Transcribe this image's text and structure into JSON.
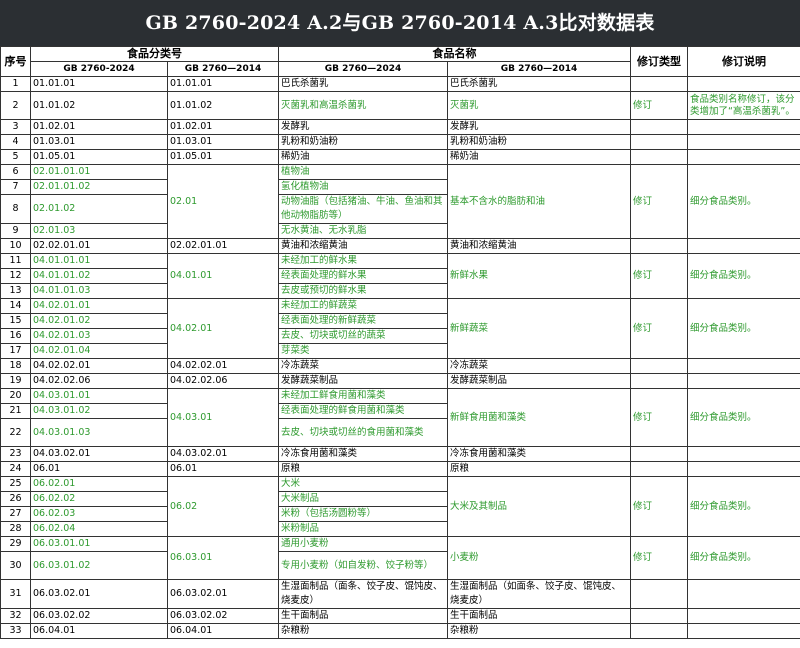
{
  "title": "GB 2760-2024 A.2与GB 2760-2014 A.3比对数据表",
  "headers": {
    "seq": "序号",
    "cat_group": "食品分类号",
    "name_group": "食品名称",
    "rev_type": "修订类型",
    "rev_note": "修订说明",
    "cat_2024": "GB 2760-2024",
    "cat_2014": "GB 2760—2014",
    "name_2024": "GB 2760—2024",
    "name_2014": "GB 2760—2014"
  },
  "colors": {
    "title_bg": "#2b2f33",
    "changed_text": "#2e9a2e"
  },
  "rows": [
    {
      "seq": "1",
      "cat24": "01.01.01",
      "cat14": "01.01.01",
      "name24": "巴氏杀菌乳",
      "name14": "巴氏杀菌乳",
      "type": "",
      "note": ""
    },
    {
      "seq": "2",
      "cat24": "01.01.02",
      "cat14": "01.01.02",
      "name24": "灭菌乳和高温杀菌乳",
      "name14": "灭菌乳",
      "type": "修订",
      "note": "食品类别名称修订，该分类增加了“高温杀菌乳”。"
    },
    {
      "seq": "3",
      "cat24": "01.02.01",
      "cat14": "01.02.01",
      "name24": "发酵乳",
      "name14": "发酵乳",
      "type": "",
      "note": ""
    },
    {
      "seq": "4",
      "cat24": "01.03.01",
      "cat14": "01.03.01",
      "name24": "乳粉和奶油粉",
      "name14": "乳粉和奶油粉",
      "type": "",
      "note": ""
    },
    {
      "seq": "5",
      "cat24": "01.05.01",
      "cat14": "01.05.01",
      "name24": "稀奶油",
      "name14": "稀奶油",
      "type": "",
      "note": ""
    },
    {
      "seq": "6",
      "cat24": "02.01.01.01",
      "name24": "植物油"
    },
    {
      "seq": "7",
      "cat24": "02.01.01.02",
      "name24": "氢化植物油"
    },
    {
      "seq": "8",
      "cat24": "02.01.02",
      "name24": "动物油脂（包括猪油、牛油、鱼油和其他动物脂肪等）"
    },
    {
      "seq": "9",
      "cat24": "02.01.03",
      "name24": "无水黄油、无水乳脂"
    },
    {
      "seq": "10",
      "cat24": "02.02.01.01",
      "cat14": "02.02.01.01",
      "name24": "黄油和浓缩黄油",
      "name14": "黄油和浓缩黄油",
      "type": "",
      "note": ""
    },
    {
      "seq": "11",
      "cat24": "04.01.01.01",
      "name24": "未经加工的鲜水果"
    },
    {
      "seq": "12",
      "cat24": "04.01.01.02",
      "name24": "经表面处理的鲜水果"
    },
    {
      "seq": "13",
      "cat24": "04.01.01.03",
      "name24": "去皮或预切的鲜水果"
    },
    {
      "seq": "14",
      "cat24": "04.02.01.01",
      "name24": "未经加工的鲜蔬菜"
    },
    {
      "seq": "15",
      "cat24": "04.02.01.02",
      "name24": "经表面处理的新鲜蔬菜"
    },
    {
      "seq": "16",
      "cat24": "04.02.01.03",
      "name24": "去皮、切块或切丝的蔬菜"
    },
    {
      "seq": "17",
      "cat24": "04.02.01.04",
      "name24": "芽菜类"
    },
    {
      "seq": "18",
      "cat24": "04.02.02.01",
      "cat14": "04.02.02.01",
      "name24": "冷冻蔬菜",
      "name14": "冷冻蔬菜",
      "type": "",
      "note": ""
    },
    {
      "seq": "19",
      "cat24": "04.02.02.06",
      "cat14": "04.02.02.06",
      "name24": "发酵蔬菜制品",
      "name14": "发酵蔬菜制品",
      "type": "",
      "note": ""
    },
    {
      "seq": "20",
      "cat24": "04.03.01.01",
      "name24": "未经加工鲜食用菌和藻类"
    },
    {
      "seq": "21",
      "cat24": "04.03.01.02",
      "name24": "经表面处理的鲜食用菌和藻类"
    },
    {
      "seq": "22",
      "cat24": "04.03.01.03",
      "name24": "去皮、切块或切丝的食用菌和藻类"
    },
    {
      "seq": "23",
      "cat24": "04.03.02.01",
      "cat14": "04.03.02.01",
      "name24": "冷冻食用菌和藻类",
      "name14": "冷冻食用菌和藻类",
      "type": "",
      "note": ""
    },
    {
      "seq": "24",
      "cat24": "06.01",
      "cat14": "06.01",
      "name24": "原粮",
      "name14": "原粮",
      "type": "",
      "note": ""
    },
    {
      "seq": "25",
      "cat24": "06.02.01",
      "name24": "大米"
    },
    {
      "seq": "26",
      "cat24": "06.02.02",
      "name24": "大米制品"
    },
    {
      "seq": "27",
      "cat24": "06.02.03",
      "name24": "米粉（包括汤圆粉等）"
    },
    {
      "seq": "28",
      "cat24": "06.02.04",
      "name24": "米粉制品"
    },
    {
      "seq": "29",
      "cat24": "06.03.01.01",
      "name24": "通用小麦粉"
    },
    {
      "seq": "30",
      "cat24": "06.03.01.02",
      "name24": "专用小麦粉（如自发粉、饺子粉等）"
    },
    {
      "seq": "31",
      "cat24": "06.03.02.01",
      "cat14": "06.03.02.01",
      "name24": "生湿面制品（面条、饺子皮、馄饨皮、烧麦皮）",
      "name14": "生湿面制品（如面条、饺子皮、馄饨皮、烧麦皮）",
      "type": "",
      "note": ""
    },
    {
      "seq": "32",
      "cat24": "06.03.02.02",
      "cat14": "06.03.02.02",
      "name24": "生干面制品",
      "name14": "生干面制品",
      "type": "",
      "note": ""
    },
    {
      "seq": "33",
      "cat24": "06.04.01",
      "cat14": "06.04.01",
      "name24": "杂粮粉",
      "name14": "杂粮粉",
      "type": "",
      "note": ""
    }
  ],
  "groups": [
    {
      "start": 6,
      "cat14": "02.01",
      "name14": "基本不含水的脂肪和油",
      "type": "修订",
      "note": "细分食品类别。"
    },
    {
      "start": 11,
      "cat14": "04.01.01",
      "name14": "新鲜水果",
      "type": "修订",
      "note": "细分食品类别。"
    },
    {
      "start": 14,
      "cat14": "04.02.01",
      "name14": "新鲜蔬菜",
      "type": "修订",
      "note": "细分食品类别。"
    },
    {
      "start": 20,
      "cat14": "04.03.01",
      "name14": "新鲜食用菌和藻类",
      "type": "修订",
      "note": "细分食品类别。"
    },
    {
      "start": 25,
      "cat14": "06.02",
      "name14": "大米及其制品",
      "type": "修订",
      "note": "细分食品类别。"
    },
    {
      "start": 29,
      "cat14": "06.03.01",
      "name14": "小麦粉",
      "type": "修订",
      "note": "细分食品类别。"
    }
  ]
}
